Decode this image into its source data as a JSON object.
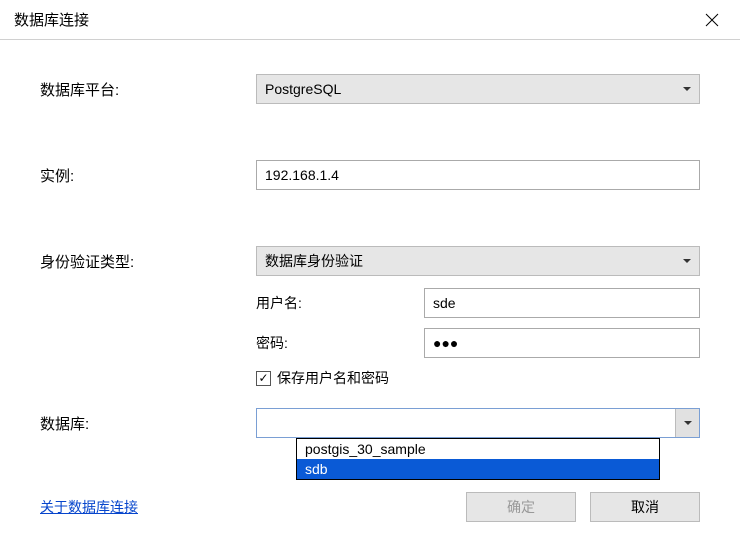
{
  "window": {
    "title": "数据库连接"
  },
  "labels": {
    "platform": "数据库平台:",
    "instance": "实例:",
    "authType": "身份验证类型:",
    "username": "用户名:",
    "password": "密码:",
    "saveCreds": "保存用户名和密码",
    "database": "数据库:"
  },
  "values": {
    "platform": "PostgreSQL",
    "instance": "192.168.1.4",
    "authType": "数据库身份验证",
    "username": "sde",
    "password": "●●●",
    "database": "",
    "saveCredsChecked": true
  },
  "dropdown": {
    "options": [
      "postgis_30_sample",
      "sdb"
    ],
    "highlighted": "sdb"
  },
  "link": {
    "about": "关于数据库连接"
  },
  "buttons": {
    "ok": "确定",
    "cancel": "取消"
  }
}
